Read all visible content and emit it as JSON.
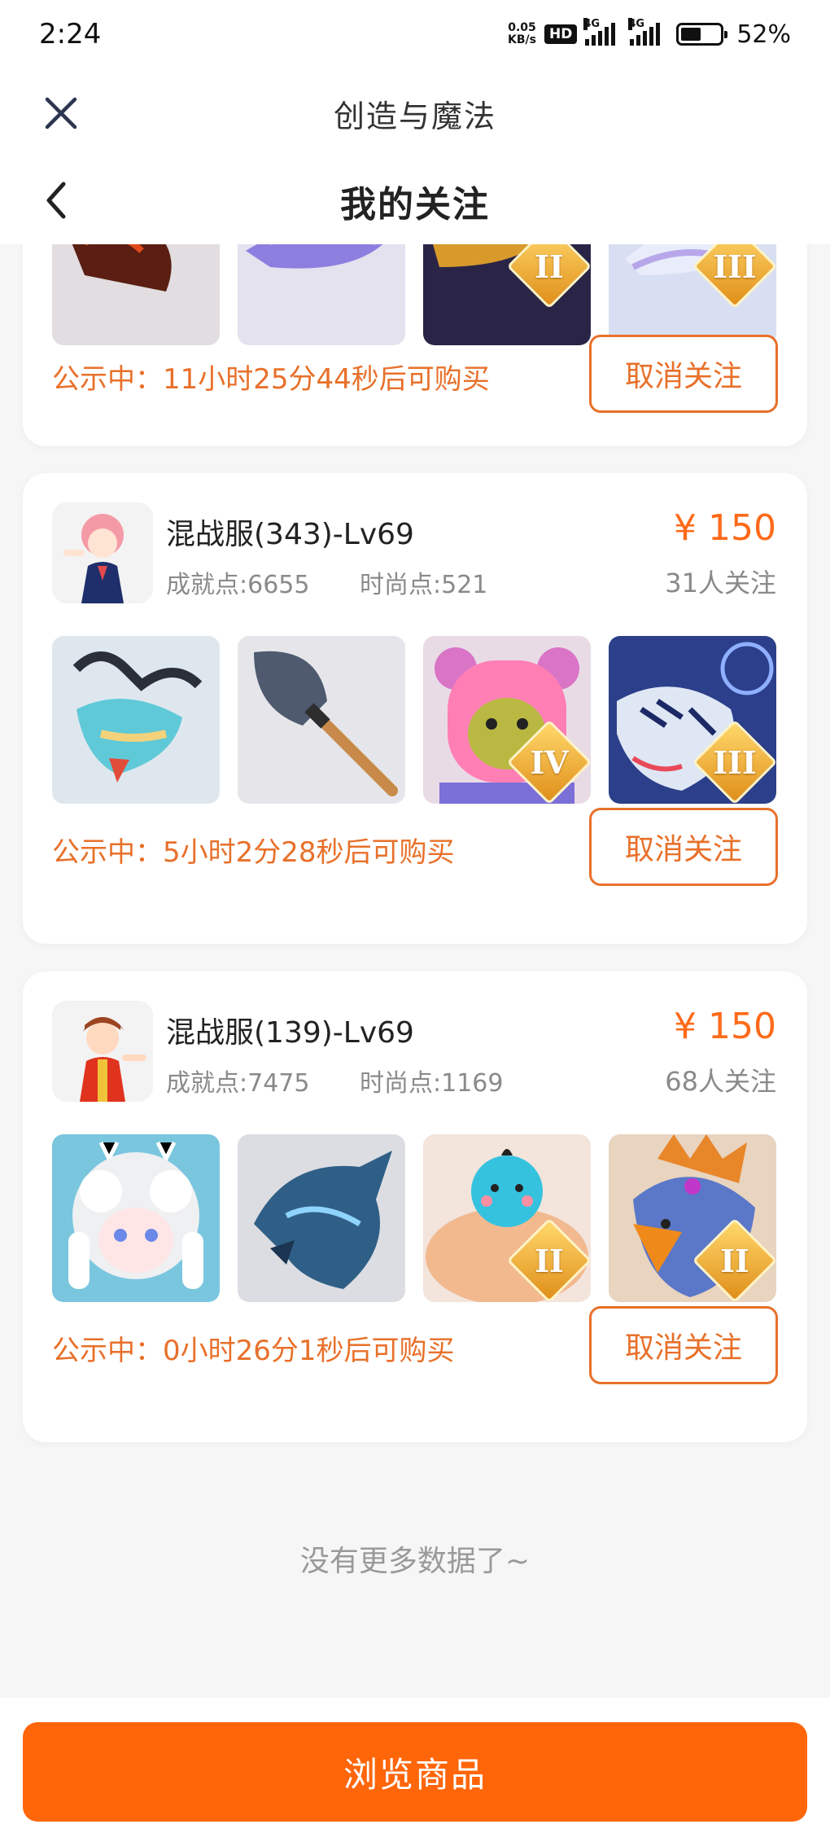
{
  "status_bar": {
    "time": "2:24",
    "net_speed_value": "0.05",
    "net_speed_unit": "KB/s",
    "hd_label": "HD",
    "network_1": "4G",
    "network_2": "4G",
    "battery_level": 52,
    "battery_text": "52%"
  },
  "app_header": {
    "title": "创造与魔法",
    "close_icon": "close-icon"
  },
  "page_header": {
    "title": "我的关注",
    "back_icon": "chevron-left-icon"
  },
  "listings": [
    {
      "partial": true,
      "items": [
        {
          "name": "red-dragon-item",
          "tier": ""
        },
        {
          "name": "purple-dragon-item",
          "tier": ""
        },
        {
          "name": "gold-beast-item",
          "tier": "II"
        },
        {
          "name": "pale-creature-item",
          "tier": "III"
        }
      ],
      "countdown": "公示中：11小时25分44秒后可购买",
      "unfollow_label": "取消关注"
    },
    {
      "server": "混战服(343)-Lv69",
      "achievement": "成就点:6655",
      "fashion": "时尚点:521",
      "price": "¥ 150",
      "followers": "31人关注",
      "items": [
        {
          "name": "cyan-dragon-item",
          "tier": ""
        },
        {
          "name": "shovel-item",
          "tier": ""
        },
        {
          "name": "pink-bear-item",
          "tier": "IV"
        },
        {
          "name": "frost-tiger-item",
          "tier": "III"
        }
      ],
      "countdown": "公示中：5小时2分28秒后可购买",
      "unfollow_label": "取消关注"
    },
    {
      "server": "混战服(139)-Lv69",
      "achievement": "成就点:7475",
      "fashion": "时尚点:1169",
      "price": "¥ 150",
      "followers": "68人关注",
      "items": [
        {
          "name": "cloud-spirit-item",
          "tier": ""
        },
        {
          "name": "ice-dragon-item",
          "tier": ""
        },
        {
          "name": "blue-bird-head-item",
          "tier": "II"
        },
        {
          "name": "griffin-item",
          "tier": "II"
        }
      ],
      "countdown": "公示中：0小时26分1秒后可购买",
      "unfollow_label": "取消关注"
    }
  ],
  "no_more_text": "没有更多数据了~",
  "browse_button": "浏览商品",
  "colors": {
    "accent": "#e8702a",
    "price": "#ff6a1a",
    "button": "#ff6609"
  }
}
